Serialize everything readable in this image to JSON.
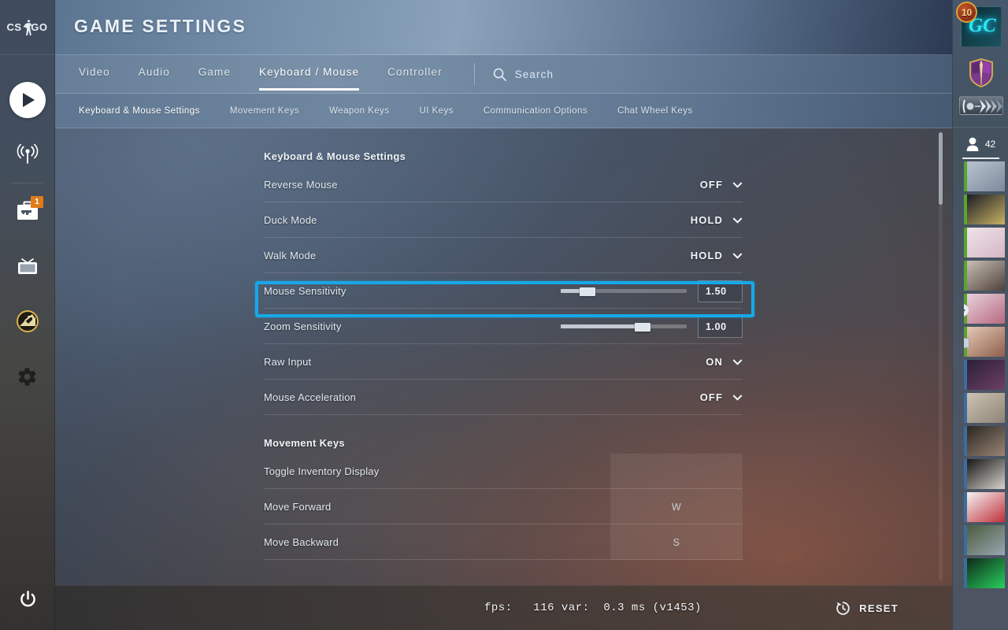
{
  "app": {
    "logo": "csgo-logo",
    "title": "GAME SETTINGS"
  },
  "rail": {
    "items": [
      {
        "name": "play-button",
        "icon": "play-icon"
      },
      {
        "name": "watch-broadcast",
        "icon": "broadcast-antenna-icon"
      },
      {
        "name": "inventory",
        "icon": "weapon-case-icon",
        "badge": "1"
      },
      {
        "name": "watch",
        "icon": "tv-icon"
      },
      {
        "name": "stats",
        "icon": "medal-stats-icon"
      },
      {
        "name": "settings",
        "icon": "gear-icon"
      }
    ],
    "power": {
      "name": "quit-button",
      "icon": "power-icon"
    }
  },
  "tabs": [
    {
      "label": "Video",
      "active": false
    },
    {
      "label": "Audio",
      "active": false
    },
    {
      "label": "Game",
      "active": false
    },
    {
      "label": "Keyboard / Mouse",
      "active": true
    },
    {
      "label": "Controller",
      "active": false
    }
  ],
  "search": {
    "icon": "search-icon",
    "label": "Search"
  },
  "subtabs": [
    {
      "label": "Keyboard & Mouse Settings",
      "active": true
    },
    {
      "label": "Movement Keys",
      "active": false
    },
    {
      "label": "Weapon Keys",
      "active": false
    },
    {
      "label": "UI Keys",
      "active": false
    },
    {
      "label": "Communication Options",
      "active": false
    },
    {
      "label": "Chat Wheel Keys",
      "active": false
    }
  ],
  "sections": [
    {
      "heading": "Keyboard & Mouse Settings",
      "rows": [
        {
          "label": "Reverse Mouse",
          "type": "dropdown",
          "value": "OFF"
        },
        {
          "label": "Duck Mode",
          "type": "dropdown",
          "value": "HOLD"
        },
        {
          "label": "Walk Mode",
          "type": "dropdown",
          "value": "HOLD"
        },
        {
          "label": "Mouse Sensitivity",
          "type": "slider",
          "value": "1.50",
          "fill_percent": 21,
          "highlighted": true
        },
        {
          "label": "Zoom Sensitivity",
          "type": "slider",
          "value": "1.00",
          "fill_percent": 65,
          "highlighted": false
        },
        {
          "label": "Raw Input",
          "type": "dropdown",
          "value": "ON"
        },
        {
          "label": "Mouse Acceleration",
          "type": "dropdown",
          "value": "OFF"
        }
      ]
    },
    {
      "heading": "Movement Keys",
      "rows": [
        {
          "label": "Toggle Inventory Display",
          "type": "keybind",
          "value": ""
        },
        {
          "label": "Move Forward",
          "type": "keybind",
          "value": "W"
        },
        {
          "label": "Move Backward",
          "type": "keybind",
          "value": "S"
        }
      ]
    }
  ],
  "highlight": {
    "target": "Mouse Sensitivity",
    "color": "#17a8e8"
  },
  "footer": {
    "fps_text": "fps:   116 var:  0.3 ms (v1453)",
    "reset_label": "RESET",
    "reset_icon": "reset-clock-icon"
  },
  "right_panel": {
    "profile": {
      "avatar_text": "GC",
      "level": "10",
      "rank_medal": "purple-shield-medal",
      "skill_group": "skill-group-rank-icon"
    },
    "friends": {
      "icon": "person-icon",
      "count": "42",
      "items": [
        {
          "status": "#56a630",
          "c1": "#b9c3cf",
          "c2": "#7d8a9c",
          "marker": ""
        },
        {
          "status": "#56a630",
          "c1": "#1a1d24",
          "c2": "#c9b264",
          "marker": ""
        },
        {
          "status": "#56a630",
          "c1": "#efe3e8",
          "c2": "#d4b7c4",
          "marker": ""
        },
        {
          "status": "#56a630",
          "c1": "#c9bfb6",
          "c2": "#4e4139",
          "marker": ""
        },
        {
          "status": "#56a630",
          "c1": "#e8d2dd",
          "c2": "#b7697f",
          "marker": "ingame"
        },
        {
          "status": "#56a630",
          "c1": "#e4c8b4",
          "c2": "#8e5f4c",
          "marker": "tv"
        },
        {
          "status": "#3a6e9e",
          "c1": "#2b2038",
          "c2": "#6d3f63",
          "marker": ""
        },
        {
          "status": "#3a6e9e",
          "c1": "#cdc2b4",
          "c2": "#8e8475",
          "marker": ""
        },
        {
          "status": "#3a6e9e",
          "c1": "#2a2622",
          "c2": "#9a8574",
          "marker": ""
        },
        {
          "status": "#3a6e9e",
          "c1": "#171717",
          "c2": "#d8d2cc",
          "marker": ""
        },
        {
          "status": "#3a6e9e",
          "c1": "#f4f4f4",
          "c2": "#c0303a",
          "marker": ""
        },
        {
          "status": "#3a6e9e",
          "c1": "#4a5c3e",
          "c2": "#9aa6b2",
          "marker": ""
        },
        {
          "status": "#3a6e9e",
          "c1": "#0d2a18",
          "c2": "#2ad05e",
          "marker": ""
        }
      ]
    }
  }
}
